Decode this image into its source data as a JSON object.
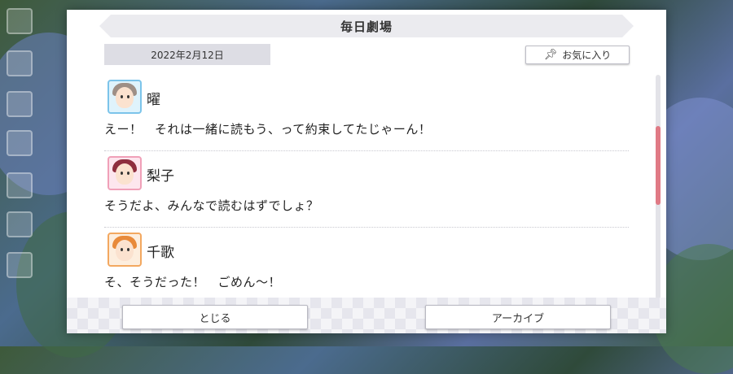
{
  "modal": {
    "title": "毎日劇場",
    "date": "2022年2月12日",
    "favorite_label": "お気に入り",
    "close_label": "とじる",
    "archive_label": "アーカイブ"
  },
  "entries": [
    {
      "speaker": "曜",
      "text": "えー！　それは一緒に読もう、って約束してたじゃーん！"
    },
    {
      "speaker": "梨子",
      "text": "そうだよ、みんなで読むはずでしょ？"
    },
    {
      "speaker": "千歌",
      "text": "そ、そうだった！　ごめん～！"
    }
  ],
  "scroll": {
    "position_fraction": 0.35,
    "visible_fraction": 0.35
  },
  "colors": {
    "accent_scroll": "#e07a85",
    "title_bar": "#ebebef",
    "date_box": "#dddde4"
  }
}
